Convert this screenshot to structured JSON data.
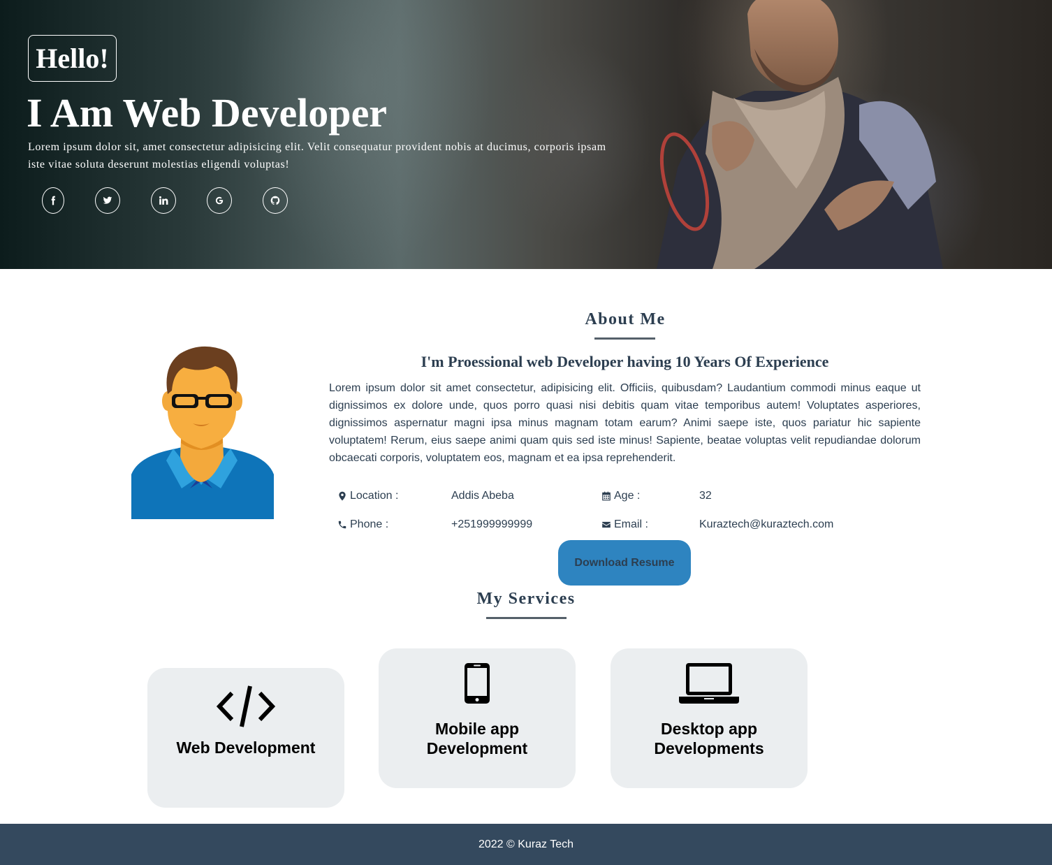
{
  "hero": {
    "greeting": "Hello!",
    "title": "I Am Web Developer",
    "subtitle": "Lorem ipsum dolor sit, amet consectetur adipisicing elit. Velit consequatur provident nobis at ducimus, corporis ipsam iste vitae soluta deserunt molestias eligendi voluptas!",
    "socials": [
      {
        "icon": "facebook-icon"
      },
      {
        "icon": "twitter-icon"
      },
      {
        "icon": "linkedin-icon"
      },
      {
        "icon": "google-icon"
      },
      {
        "icon": "github-icon"
      }
    ]
  },
  "about": {
    "title": "About Me",
    "heading": "I'm Proessional web Developer having 10 Years Of Experience",
    "text": "Lorem ipsum dolor sit amet consectetur, adipisicing elit. Officiis, quibusdam? Laudantium commodi minus eaque ut dignissimos ex dolore unde, quos porro quasi nisi debitis quam vitae temporibus autem! Voluptates asperiores, dignissimos aspernatur magni ipsa minus magnam totam earum? Animi saepe iste, quos pariatur hic sapiente voluptatem! Rerum, eius saepe animi quam quis sed iste minus! Sapiente, beatae voluptas velit repudiandae dolorum obcaecati corporis, voluptatem eos, magnam et ea ipsa reprehenderit.",
    "info": {
      "location_label": "Location :",
      "location_value": "Addis Abeba",
      "age_label": "Age :",
      "age_value": "32",
      "phone_label": "Phone :",
      "phone_value": "+251999999999",
      "email_label": "Email :",
      "email_value": "Kuraztech@kuraztech.com"
    },
    "download_label": "Download Resume"
  },
  "services": {
    "title": "My Services",
    "items": [
      {
        "label": "Web Development",
        "icon": "code-icon"
      },
      {
        "label": "Mobile app Development",
        "icon": "mobile-phone-icon"
      },
      {
        "label": "Desktop app Developments",
        "icon": "laptop-icon"
      }
    ]
  },
  "footer": {
    "text": "2022 © Kuraz Tech"
  },
  "colors": {
    "primary_text": "#2c3e50",
    "button": "#2e84c0",
    "card_bg": "#ebeef0",
    "footer_bg": "#34495e"
  }
}
